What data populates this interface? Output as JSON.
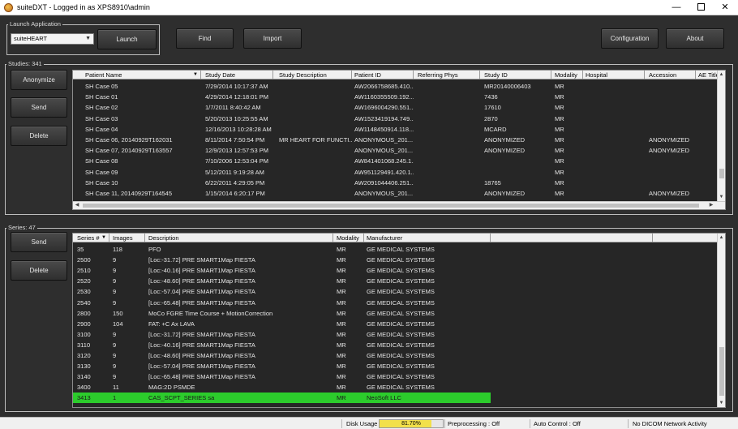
{
  "window": {
    "title": "suiteDXT - Logged in as XPS8910\\admin",
    "minimize_glyph": "—",
    "close_glyph": "✕"
  },
  "launch": {
    "group_label": "Launch Application",
    "selected_app": "suiteHEART",
    "launch_label": "Launch"
  },
  "toolbar": {
    "find_label": "Find",
    "import_label": "Import",
    "configuration_label": "Configuration",
    "about_label": "About"
  },
  "studies": {
    "group_label": "Studies: 341",
    "buttons": {
      "anonymize": "Anonymize",
      "send": "Send",
      "delete": "Delete"
    },
    "columns": [
      "Patient Name",
      "Study Date",
      "Study Description",
      "Patient ID",
      "Referring Phys",
      "Study ID",
      "Modality",
      "Hospital",
      "Accession",
      "AE Title"
    ],
    "rows": [
      [
        "SH Case  05",
        "7/29/2014 10:17:37 AM",
        "",
        "AW2066758685.410....",
        "",
        "MR20140006403",
        "MR",
        "",
        "",
        ""
      ],
      [
        "SH Case 01",
        "4/29/2014 12:18:01 PM",
        "",
        "AW1160355509.192....",
        "",
        "7436",
        "MR",
        "",
        "",
        ""
      ],
      [
        "SH Case 02",
        "1/7/2011 8:40:42 AM",
        "",
        "AW1696004290.551....",
        "",
        "17610",
        "MR",
        "",
        "",
        ""
      ],
      [
        "SH Case 03",
        "5/20/2013 10:25:55 AM",
        "",
        "AW1523419194.749....",
        "",
        "2870",
        "MR",
        "",
        "",
        ""
      ],
      [
        "SH Case 04",
        "12/16/2013 10:28:28 AM",
        "",
        "AW1148450914.118....",
        "",
        "MCARD",
        "MR",
        "",
        "",
        ""
      ],
      [
        "SH Case 06, 20140929T162031",
        "8/11/2014 7:50:54 PM",
        "MR HEART FOR FUNCTI...",
        "ANONYMOUS_201...",
        "",
        "ANONYMIZED",
        "MR",
        "",
        "ANONYMIZED",
        ""
      ],
      [
        "SH Case 07, 20140929T163557",
        "12/9/2013 12:57:53 PM",
        "",
        "ANONYMOUS_201...",
        "",
        "ANONYMIZED",
        "MR",
        "",
        "ANONYMIZED",
        ""
      ],
      [
        "SH Case 08",
        "7/10/2006 12:53:04 PM",
        "",
        "AW841401068.245.1...",
        "",
        "",
        "MR",
        "",
        "",
        ""
      ],
      [
        "SH Case 09",
        "5/12/2011 9:19:28 AM",
        "",
        "AW951129491.420.1...",
        "",
        "",
        "MR",
        "",
        "",
        ""
      ],
      [
        "SH Case 10",
        "6/22/2011 4:29:05 PM",
        "",
        "AW2091044406.251....",
        "",
        "18765",
        "MR",
        "",
        "",
        ""
      ],
      [
        "SH Case 11, 20140929T164545",
        "1/15/2014 6:20:17 PM",
        "",
        "ANONYMOUS_201...",
        "",
        "ANONYMIZED",
        "MR",
        "",
        "ANONYMIZED",
        ""
      ]
    ]
  },
  "series": {
    "group_label": "Series: 47",
    "buttons": {
      "send": "Send",
      "delete": "Delete"
    },
    "columns": [
      "Series #",
      "Images",
      "Description",
      "Modality",
      "Manufacturer"
    ],
    "rows": [
      [
        "35",
        "118",
        "PFO",
        "MR",
        "GE MEDICAL SYSTEMS"
      ],
      [
        "2500",
        "9",
        "[Loc:-31.72] PRE SMART1Map FIESTA",
        "MR",
        "GE MEDICAL SYSTEMS"
      ],
      [
        "2510",
        "9",
        "[Loc:-40.16] PRE SMART1Map FIESTA",
        "MR",
        "GE MEDICAL SYSTEMS"
      ],
      [
        "2520",
        "9",
        "[Loc:-48.60] PRE SMART1Map FIESTA",
        "MR",
        "GE MEDICAL SYSTEMS"
      ],
      [
        "2530",
        "9",
        "[Loc:-57.04] PRE SMART1Map FIESTA",
        "MR",
        "GE MEDICAL SYSTEMS"
      ],
      [
        "2540",
        "9",
        "[Loc:-65.48] PRE SMART1Map FIESTA",
        "MR",
        "GE MEDICAL SYSTEMS"
      ],
      [
        "2800",
        "150",
        "MoCo FGRE Time Course + MotionCorrection",
        "MR",
        "GE MEDICAL SYSTEMS"
      ],
      [
        "2900",
        "104",
        "FAT: +C Ax LAVA",
        "MR",
        "GE MEDICAL SYSTEMS"
      ],
      [
        "3100",
        "9",
        "[Loc:-31.72] PRE SMART1Map FIESTA",
        "MR",
        "GE MEDICAL SYSTEMS"
      ],
      [
        "3110",
        "9",
        "[Loc:-40.16] PRE SMART1Map FIESTA",
        "MR",
        "GE MEDICAL SYSTEMS"
      ],
      [
        "3120",
        "9",
        "[Loc:-48.60] PRE SMART1Map FIESTA",
        "MR",
        "GE MEDICAL SYSTEMS"
      ],
      [
        "3130",
        "9",
        "[Loc:-57.04] PRE SMART1Map FIESTA",
        "MR",
        "GE MEDICAL SYSTEMS"
      ],
      [
        "3140",
        "9",
        "[Loc:-65.48] PRE SMART1Map FIESTA",
        "MR",
        "GE MEDICAL SYSTEMS"
      ],
      [
        "3400",
        "11",
        "MAG:2D PSMDE",
        "MR",
        "GE MEDICAL SYSTEMS"
      ],
      [
        "3413",
        "1",
        "CAS_SCPT_SERIES sa",
        "MR",
        "NeoSoft LLC"
      ]
    ],
    "selected_row_index": 14,
    "selected_color": "#2ccc2c"
  },
  "status": {
    "disk_usage_label": "Disk Usage",
    "disk_usage_value": "81.70%",
    "disk_usage_fraction": 0.817,
    "preprocessing": "Preprocessing : Off",
    "auto_control": "Auto Control : Off",
    "network": "No DICOM Network Activity"
  }
}
